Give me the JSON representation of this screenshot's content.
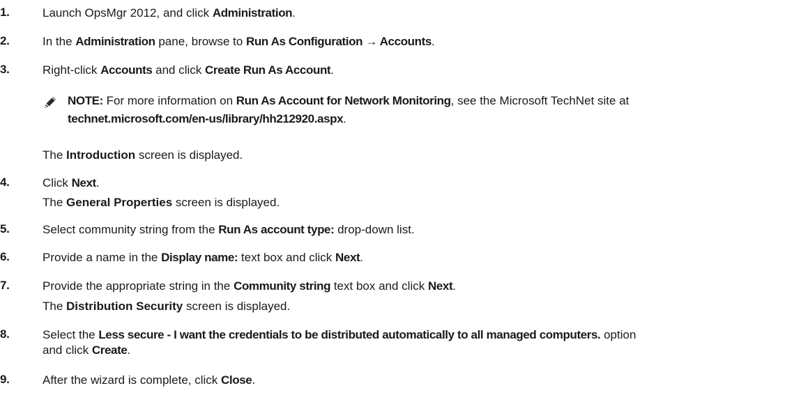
{
  "steps": [
    {
      "num": "1.",
      "p": [
        "Launch OpsMgr 2012, and click ",
        "Administration",
        "."
      ]
    },
    {
      "num": "2.",
      "p": [
        "In the ",
        "Administration",
        " pane, browse to ",
        "Run As Configuration → Accounts",
        "."
      ]
    },
    {
      "num": "3.",
      "p": [
        "Right-click ",
        "Accounts",
        " and click ",
        "Create Run As Account",
        "."
      ]
    },
    {
      "num": "4.",
      "p": [
        "Click ",
        "Next",
        "."
      ]
    },
    {
      "num": "5.",
      "p": [
        "Select community string from the ",
        "Run As account type:",
        " drop-down list."
      ]
    },
    {
      "num": "6.",
      "p": [
        "Provide a name in the ",
        "Display name:",
        " text box and click ",
        "Next",
        "."
      ]
    },
    {
      "num": "7.",
      "p": [
        "Provide the appropriate string in the ",
        "Community string",
        " text box and click ",
        "Next",
        "."
      ]
    },
    {
      "num": "8.",
      "p": [
        "Select the ",
        "Less secure - I want the credentials to be distributed automatically to all managed computers.",
        " option",
        "and click ",
        "Create",
        "."
      ]
    },
    {
      "num": "9.",
      "p": [
        "After the wizard is complete, click ",
        "Close",
        "."
      ]
    }
  ],
  "note": {
    "icon": "pencil-note-icon",
    "label": "NOTE:",
    "t1": " For more information on ",
    "b1": "Run As Account for Network Monitoring",
    "t2": ", see the Microsoft TechNet site at",
    "link": "technet.microsoft.com/en-us/library/hh212920.aspx",
    "t3": "."
  },
  "sub": {
    "s3_a": "The ",
    "s3_b": "Introduction",
    "s3_c": " screen is displayed.",
    "s4_a": "The ",
    "s4_b": "General Properties",
    "s4_c": " screen is displayed.",
    "s7_a": "The ",
    "s7_b": "Distribution Security",
    "s7_c": " screen is displayed."
  }
}
